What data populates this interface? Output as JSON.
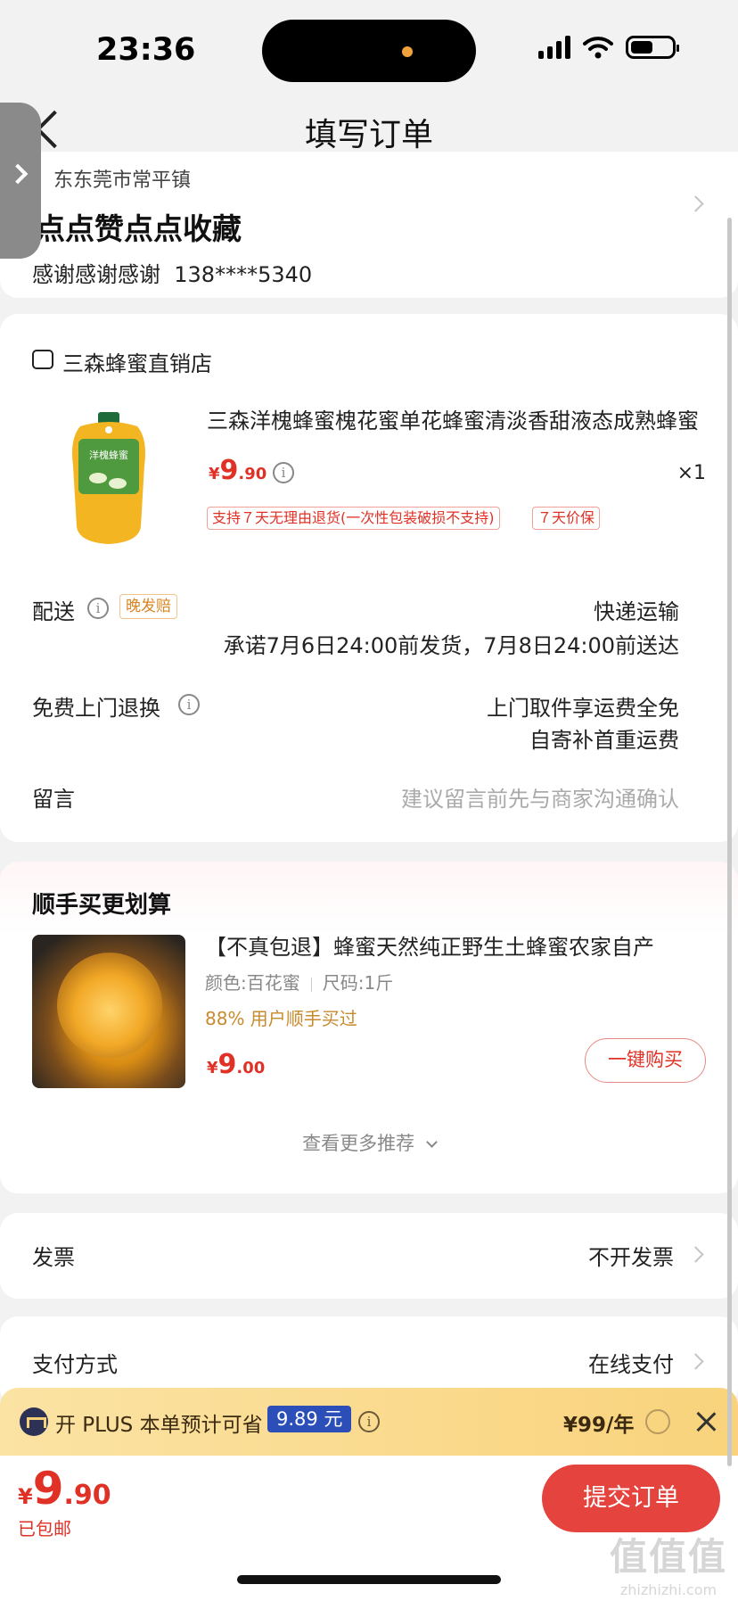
{
  "status_bar": {
    "time": "23:36"
  },
  "nav": {
    "title": "填写订单"
  },
  "address": {
    "region": "东东莞市常平镇",
    "name": "点点赞点点收藏",
    "contact_name": "感谢感谢感谢",
    "phone": "138****5340"
  },
  "shop": {
    "name": "三森蜂蜜直销店",
    "product": {
      "title": "三森洋槐蜂蜜槐花蜜单花蜂蜜清淡香甜液态成熟蜂蜜",
      "image_label": "洋槐蜂蜜",
      "price_currency": "¥",
      "price_int": "9",
      "price_dec": ".90",
      "quantity": "×1",
      "tags": [
        "支持７天无理由退货(一次性包装破损不支持)",
        "７天价保"
      ]
    },
    "delivery": {
      "label": "配送",
      "tag": "晚发赔",
      "method": "快递运输",
      "promise": "承诺7月6日24:00前发货，7月8日24:00前送达"
    },
    "return": {
      "label": "免费上门退换",
      "line1": "上门取件享运费全免",
      "line2": "自寄补首重运费"
    },
    "message": {
      "label": "留言",
      "placeholder": "建议留言前先与商家沟通确认"
    }
  },
  "recommend": {
    "title": "顺手买更划算",
    "item": {
      "name": "【不真包退】蜂蜜天然纯正野生土蜂蜜农家自产",
      "color": "颜色:百花蜜",
      "size": "尺码:1斤",
      "bought": "88% 用户顺手买过",
      "price_currency": "¥",
      "price_int": "9",
      "price_dec": ".00",
      "buy_button": "一键购买"
    },
    "more": "查看更多推荐"
  },
  "invoice": {
    "label": "发票",
    "value": "不开发票"
  },
  "payment": {
    "label": "支付方式",
    "value": "在线支付"
  },
  "plus": {
    "text": "开 PLUS 本单预计可省",
    "save": "9.89 元",
    "price": "¥99/年"
  },
  "footer": {
    "total_currency": "¥",
    "total_int": "9",
    "total_dec": ".90",
    "shipping": "已包邮",
    "submit": "提交订单",
    "watermark": "值值值",
    "watermark_sub": "zhizhizhi.com"
  },
  "colors": {
    "accent": "#e03126",
    "plus_bg": "#f9d37c",
    "submit_bg": "#e5433e"
  }
}
